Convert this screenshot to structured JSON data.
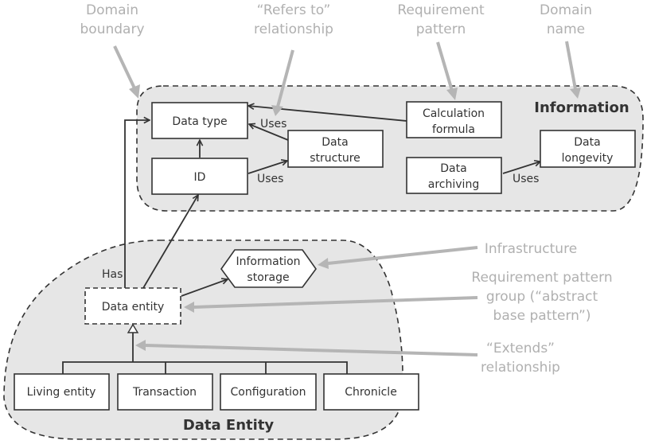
{
  "diagram": {
    "domains": {
      "information": {
        "name": "Information"
      },
      "data_entity": {
        "name": "Data Entity"
      }
    },
    "nodes": {
      "data_type": {
        "lines": [
          "Data type"
        ]
      },
      "id": {
        "lines": [
          "ID"
        ]
      },
      "data_structure": {
        "lines": [
          "Data",
          "structure"
        ]
      },
      "calculation_formula": {
        "lines": [
          "Calculation",
          "formula"
        ]
      },
      "data_archiving": {
        "lines": [
          "Data",
          "archiving"
        ]
      },
      "data_longevity": {
        "lines": [
          "Data",
          "longevity"
        ]
      },
      "information_storage": {
        "lines": [
          "Information",
          "storage"
        ]
      },
      "data_entity": {
        "lines": [
          "Data entity"
        ]
      },
      "living_entity": {
        "lines": [
          "Living entity"
        ]
      },
      "transaction": {
        "lines": [
          "Transaction"
        ]
      },
      "configuration": {
        "lines": [
          "Configuration"
        ]
      },
      "chronicle": {
        "lines": [
          "Chronicle"
        ]
      }
    },
    "edge_labels": {
      "structure_uses_type": "Uses",
      "id_uses_structure": "Uses",
      "archiving_uses_longevity": "Uses",
      "entity_has_type": "Has"
    },
    "callouts": {
      "domain_boundary": {
        "lines": [
          "Domain",
          "boundary"
        ]
      },
      "refers_to": {
        "lines": [
          "“Refers to”",
          "relationship"
        ]
      },
      "requirement_pattern": {
        "lines": [
          "Requirement",
          "pattern"
        ]
      },
      "domain_name": {
        "lines": [
          "Domain",
          "name"
        ]
      },
      "infrastructure": {
        "lines": [
          "Infrastructure"
        ]
      },
      "pattern_group": {
        "lines": [
          "Requirement pattern",
          "group (“abstract",
          "base pattern”)"
        ]
      },
      "extends": {
        "lines": [
          "“Extends”",
          "relationship"
        ]
      }
    },
    "colors": {
      "domain_fill": "#e6e6e6",
      "stroke": "#333333",
      "callout": "#b5b5b5"
    }
  }
}
